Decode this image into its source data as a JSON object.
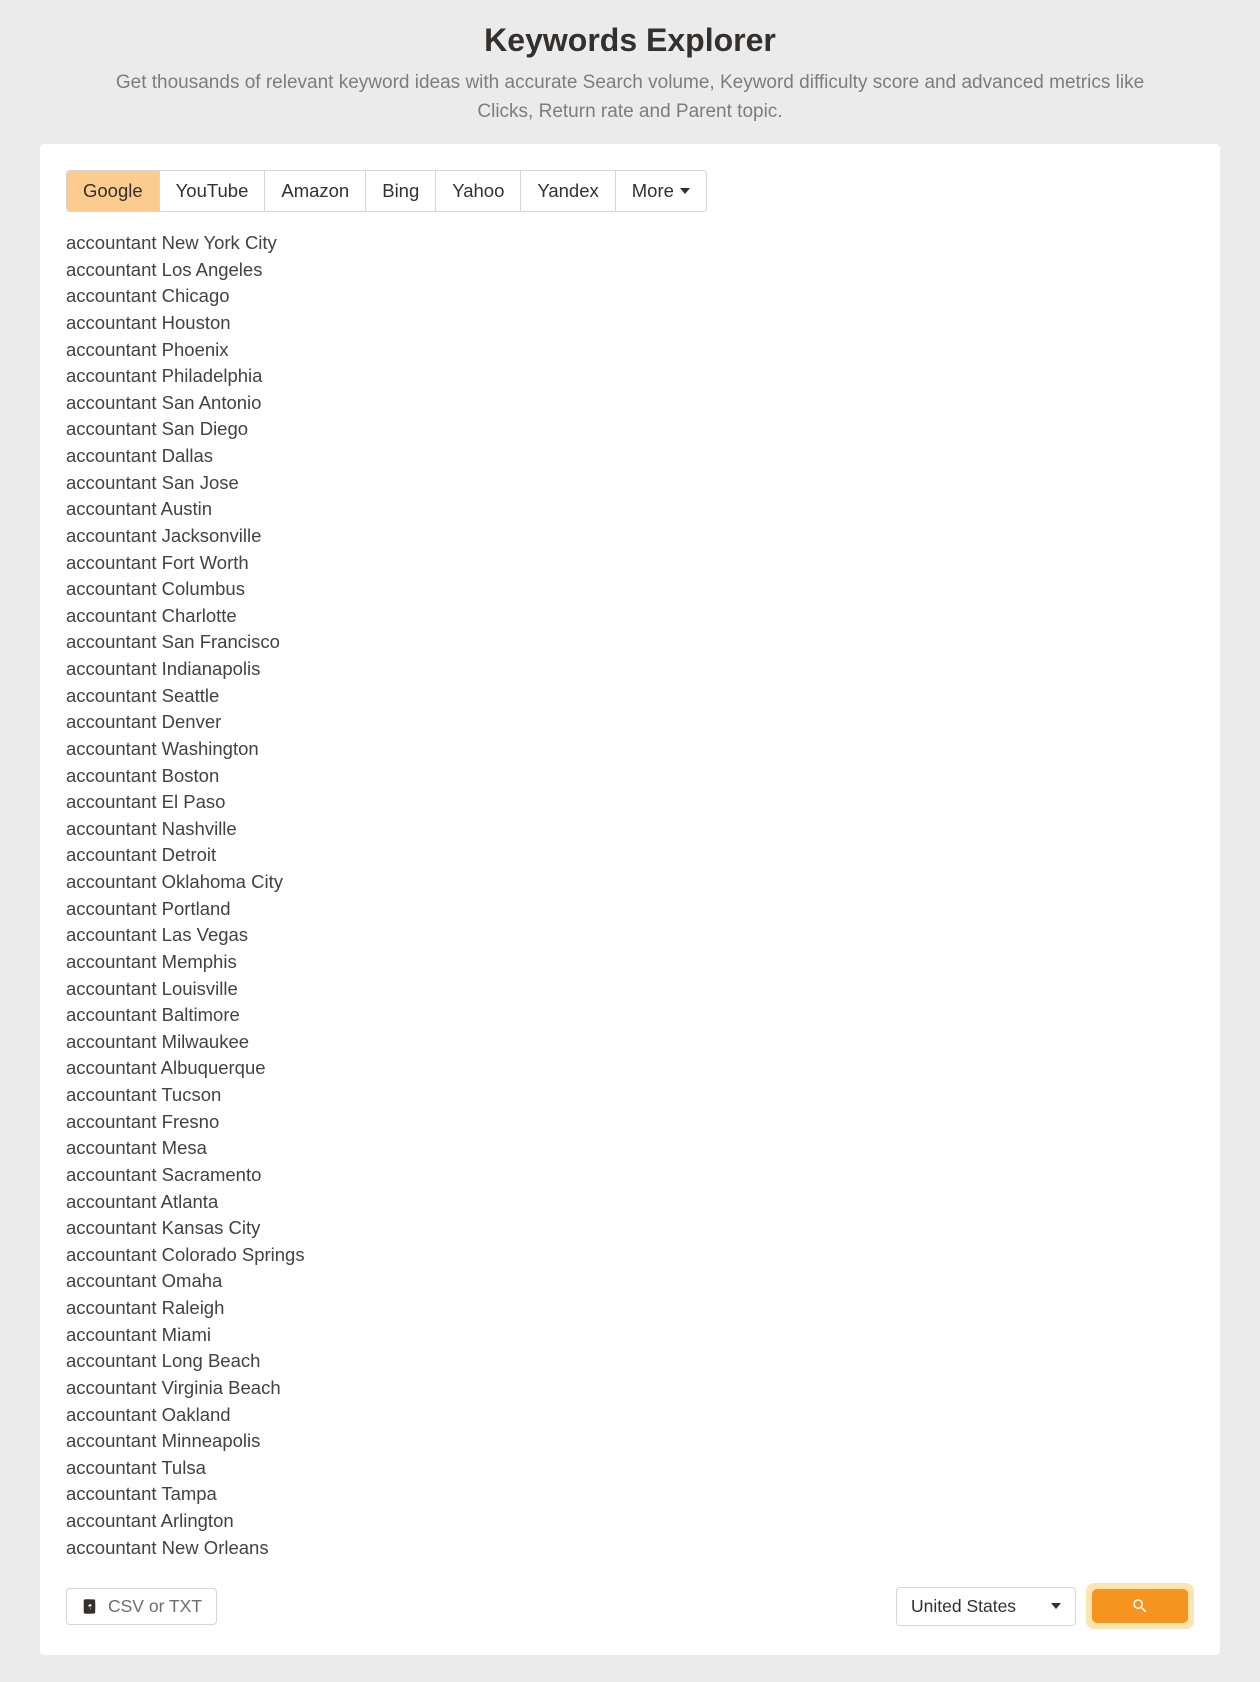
{
  "header": {
    "title": "Keywords Explorer",
    "subtitle": "Get thousands of relevant keyword ideas with accurate Search volume, Keyword difficulty score and advanced metrics like Clicks, Return rate and Parent topic."
  },
  "tabs": [
    {
      "label": "Google",
      "active": true
    },
    {
      "label": "YouTube",
      "active": false
    },
    {
      "label": "Amazon",
      "active": false
    },
    {
      "label": "Bing",
      "active": false
    },
    {
      "label": "Yahoo",
      "active": false
    },
    {
      "label": "Yandex",
      "active": false
    },
    {
      "label": "More",
      "active": false,
      "caret": true
    }
  ],
  "keywords": [
    "accountant New York City",
    "accountant Los Angeles",
    "accountant Chicago",
    "accountant Houston",
    "accountant Phoenix",
    "accountant Philadelphia",
    "accountant San Antonio",
    "accountant San Diego",
    "accountant Dallas",
    "accountant San Jose",
    "accountant Austin",
    "accountant Jacksonville",
    "accountant Fort Worth",
    "accountant Columbus",
    "accountant Charlotte",
    "accountant San Francisco",
    "accountant Indianapolis",
    "accountant Seattle",
    "accountant Denver",
    "accountant Washington",
    "accountant Boston",
    "accountant El Paso",
    "accountant Nashville",
    "accountant Detroit",
    "accountant Oklahoma City",
    "accountant Portland",
    "accountant Las Vegas",
    "accountant Memphis",
    "accountant Louisville",
    "accountant Baltimore",
    "accountant Milwaukee",
    "accountant Albuquerque",
    "accountant Tucson",
    "accountant Fresno",
    "accountant Mesa",
    "accountant Sacramento",
    "accountant Atlanta",
    "accountant Kansas City",
    "accountant Colorado Springs",
    "accountant Omaha",
    "accountant Raleigh",
    "accountant Miami",
    "accountant Long Beach",
    "accountant Virginia Beach",
    "accountant Oakland",
    "accountant Minneapolis",
    "accountant Tulsa",
    "accountant Tampa",
    "accountant Arlington",
    "accountant New Orleans"
  ],
  "footer": {
    "upload_label": "CSV or TXT",
    "country": "United States"
  }
}
